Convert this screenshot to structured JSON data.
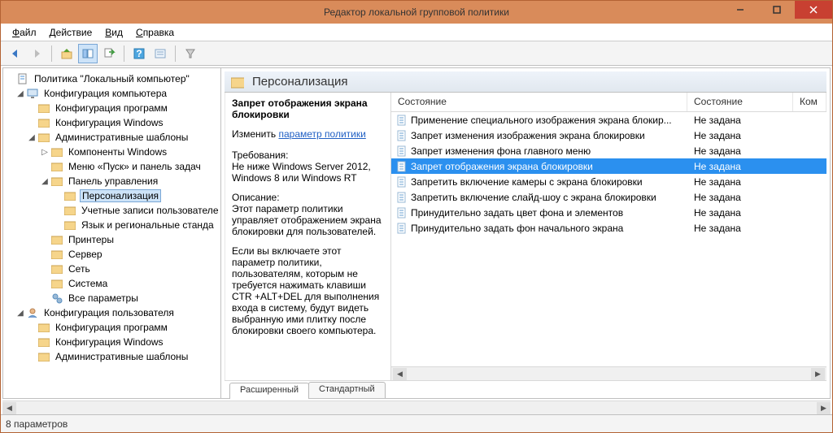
{
  "window": {
    "title": "Редактор локальной групповой политики"
  },
  "menu": {
    "file": "Файл",
    "action": "Действие",
    "view": "Вид",
    "help": "Справка"
  },
  "tree": {
    "root": "Политика \"Локальный компьютер\"",
    "computer_config": "Конфигурация компьютера",
    "software_config": "Конфигурация программ",
    "windows_config": "Конфигурация Windows",
    "admin_templates": "Административные шаблоны",
    "win_components": "Компоненты Windows",
    "start_taskbar": "Меню «Пуск» и панель задач",
    "control_panel": "Панель управления",
    "personalization": "Персонализация",
    "user_accounts": "Учетные записи пользователе",
    "lang_regional": "Язык и региональные станда",
    "printers": "Принтеры",
    "server": "Сервер",
    "network": "Сеть",
    "system": "Система",
    "all_params": "Все параметры",
    "user_config": "Конфигурация пользователя",
    "u_software_config": "Конфигурация программ",
    "u_windows_config": "Конфигурация Windows",
    "u_admin_templates": "Административные шаблоны"
  },
  "right": {
    "header": "Персонализация",
    "policy_title": "Запрет отображения экрана блокировки",
    "change_label": "Изменить",
    "change_link": "параметр политики",
    "requirements_label": "Требования:",
    "requirements_text": "Не ниже Windows Server 2012, Windows 8 или Windows RT",
    "description_label": "Описание:",
    "description_text1": "Этот параметр политики управляет отображением экрана блокировки для пользователей.",
    "description_text2": "Если вы включаете этот параметр политики, пользователям, которым не требуется нажимать клавиши CTR +ALT+DEL для выполнения входа в систему, будут видеть выбранную ими плитку после блокировки своего компьютера."
  },
  "columns": {
    "state": "Состояние",
    "state2": "Состояние",
    "comment": "Ком"
  },
  "policies": [
    {
      "name": "Применение специального изображения экрана блокир...",
      "state": "Не задана"
    },
    {
      "name": "Запрет изменения изображения экрана блокировки",
      "state": "Не задана"
    },
    {
      "name": "Запрет изменения фона главного меню",
      "state": "Не задана"
    },
    {
      "name": "Запрет отображения экрана блокировки",
      "state": "Не задана"
    },
    {
      "name": "Запретить включение камеры с экрана блокировки",
      "state": "Не задана"
    },
    {
      "name": "Запретить включение слайд-шоу с экрана блокировки",
      "state": "Не задана"
    },
    {
      "name": "Принудительно задать цвет фона и элементов",
      "state": "Не задана"
    },
    {
      "name": "Принудительно задать фон начального экрана",
      "state": "Не задана"
    }
  ],
  "tabs": {
    "extended": "Расширенный",
    "standard": "Стандартный"
  },
  "status": "8 параметров"
}
